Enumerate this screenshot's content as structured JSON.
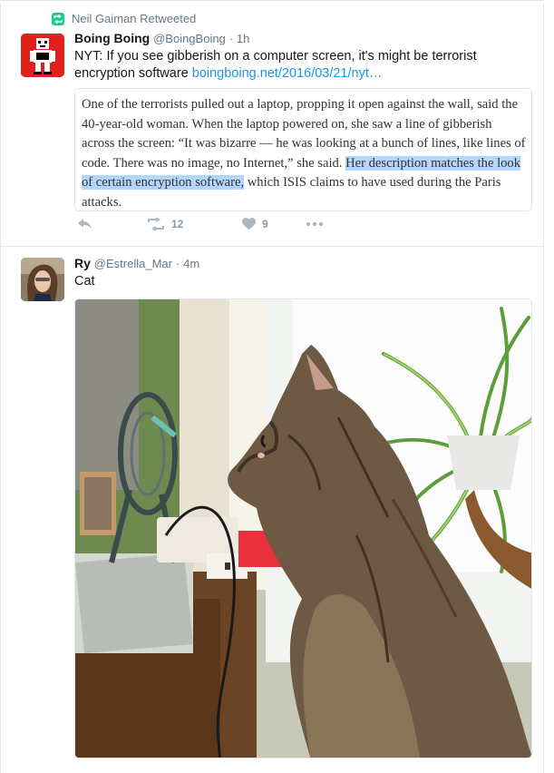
{
  "tweet1": {
    "retweet_label": "Neil Gaiman Retweeted",
    "author_name": "Boing Boing",
    "author_handle": "@BoingBoing",
    "separator": "·",
    "time": "1h",
    "text": "NYT:  If you see gibberish on a computer screen, it's might be terrorist encryption software ",
    "link": "boingboing.net/2016/03/21/nyt…",
    "quote": {
      "text_plain": "One of the terrorists pulled out a laptop, propping it open against the wall, said the 40-year-old woman. When the laptop powered on, she saw a line of gibberish across the screen: “It was bizarre — he was looking at a bunch of lines, like lines of code. There was no image, no Internet,” she said. ",
      "text_highlight": "Her description matches the look of certain encryption software,",
      "text_tail": " which ISIS claims to have used during the Paris attacks."
    },
    "actions": {
      "retweet_count": "12",
      "like_count": "9"
    }
  },
  "tweet2": {
    "author_name": "Ry",
    "author_handle": "@Estrella_Mar",
    "separator": "·",
    "time": "4m",
    "text": "Cat"
  },
  "colors": {
    "accent_link": "#1b95e0",
    "retweet_green": "#19cf86",
    "text_secondary": "#657786",
    "icon_gray": "#8899a6",
    "highlight": "#b4d5fe"
  },
  "icons": [
    "retweet-icon",
    "reply-icon",
    "like-icon",
    "more-icon"
  ]
}
